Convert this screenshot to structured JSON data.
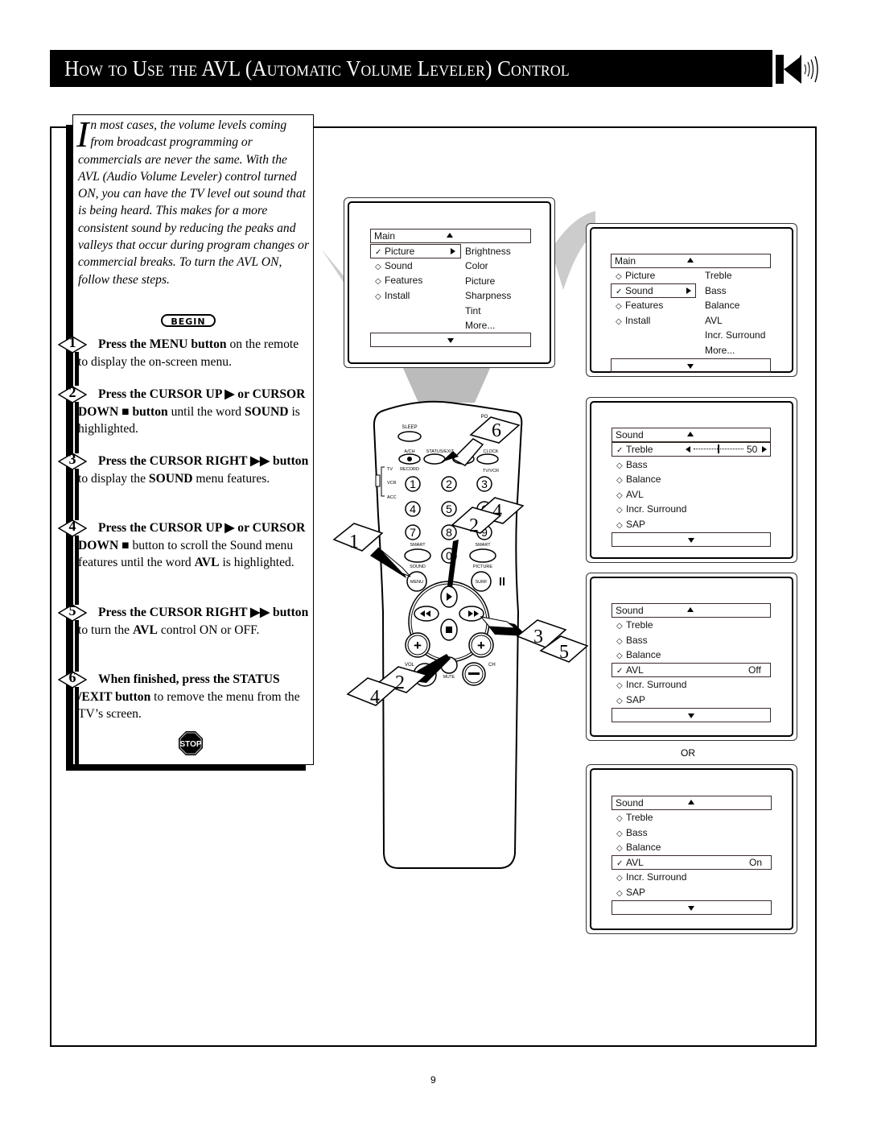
{
  "header": {
    "title": "How to Use the AVL (Automatic Volume Leveler) Control",
    "icon": "speaker-icon"
  },
  "intro": {
    "dropcap": "I",
    "text": "n most cases, the volume levels coming from broadcast programming or commercials are never the same.  With the AVL (Audio Volume Leveler) control turned ON, you can have the TV level out sound that is being heard.  This makes for a more consistent sound by reducing the peaks and valleys that occur during program changes or commercial breaks.  To turn the AVL ON, follow these steps.",
    "begin_label": "BEGIN"
  },
  "steps": [
    {
      "number": "1",
      "bold": "Press the MENU button",
      "rest": " on the remote to display the on-screen menu."
    },
    {
      "number": "2",
      "bold": "Press the CURSOR UP ▶ or CURSOR DOWN ■ button",
      "rest": " until the word ",
      "bold2": "SOUND",
      "rest2": " is highlighted."
    },
    {
      "number": "3",
      "bold": "Press the CURSOR RIGHT ▶▶ button",
      "rest": " to display the ",
      "bold2": "SOUND",
      "rest2": " menu features."
    },
    {
      "number": "4",
      "bold": "Press the CURSOR UP ▶ or CURSOR DOWN ■",
      "rest": " button to scroll the Sound menu features until the word ",
      "bold2": "AVL",
      "rest2": " is highlighted."
    },
    {
      "number": "5",
      "bold": "Press the CURSOR RIGHT ▶▶ button",
      "rest": " to turn the ",
      "bold2": "AVL",
      "rest2": " control ON or OFF."
    },
    {
      "number": "6",
      "bold": "When finished, press the STATUS /EXIT button",
      "rest": " to remove the menu from the TV’s screen."
    }
  ],
  "stop_label": "STOP",
  "screens": {
    "main_picture": {
      "header": "Main",
      "items": [
        {
          "label": "Picture",
          "marker": "✓",
          "selected": true
        },
        {
          "label": "Sound",
          "marker": "◇"
        },
        {
          "label": "Features",
          "marker": "◇"
        },
        {
          "label": "Install",
          "marker": "◇"
        }
      ],
      "submenu": [
        "Brightness",
        "Color",
        "Picture",
        "Sharpness",
        "Tint",
        "More..."
      ]
    },
    "main_sound": {
      "header": "Main",
      "items": [
        {
          "label": "Picture",
          "marker": "◇"
        },
        {
          "label": "Sound",
          "marker": "✓",
          "selected": true
        },
        {
          "label": "Features",
          "marker": "◇"
        },
        {
          "label": "Install",
          "marker": "◇"
        }
      ],
      "submenu": [
        "Treble",
        "Bass",
        "Balance",
        "AVL",
        "Incr. Surround",
        "More..."
      ]
    },
    "sound_treble": {
      "header": "Sound",
      "items": [
        {
          "label": "Treble",
          "marker": "✓",
          "selected": true,
          "value": "50"
        },
        {
          "label": "Bass",
          "marker": "◇"
        },
        {
          "label": "Balance",
          "marker": "◇"
        },
        {
          "label": "AVL",
          "marker": "◇"
        },
        {
          "label": "Incr. Surround",
          "marker": "◇"
        },
        {
          "label": "SAP",
          "marker": "◇"
        }
      ],
      "treble_slider_level": 0.5
    },
    "sound_avl_off": {
      "header": "Sound",
      "items": [
        {
          "label": "Treble",
          "marker": "◇"
        },
        {
          "label": "Bass",
          "marker": "◇"
        },
        {
          "label": "Balance",
          "marker": "◇"
        },
        {
          "label": "AVL",
          "marker": "✓",
          "selected": true,
          "value": "Off"
        },
        {
          "label": "Incr. Surround",
          "marker": "◇"
        },
        {
          "label": "SAP",
          "marker": "◇"
        }
      ]
    },
    "or_label": "OR",
    "sound_avl_on": {
      "header": "Sound",
      "items": [
        {
          "label": "Treble",
          "marker": "◇"
        },
        {
          "label": "Bass",
          "marker": "◇"
        },
        {
          "label": "Balance",
          "marker": "◇"
        },
        {
          "label": "AVL",
          "marker": "✓",
          "selected": true,
          "value": "On"
        },
        {
          "label": "Incr. Surround",
          "marker": "◇"
        },
        {
          "label": "SAP",
          "marker": "◇"
        }
      ]
    }
  },
  "remote": {
    "labels": {
      "sleep": "SLEEP",
      "ach": "A/CH",
      "status_exit": "STATUS/EXIT",
      "clock": "CLOCK",
      "record": "RECORD",
      "tvvcr": "TV/VCR",
      "tv": "TV",
      "vcr": "VCR",
      "acc": "ACC",
      "smart_sound_top": "SMART",
      "sound": "SOUND",
      "smart_picture_top": "SMART",
      "picture": "PICTURE",
      "menu": "MENU",
      "surf": "SURF",
      "vol": "VOL",
      "ch": "CH",
      "mute": "MUTE",
      "power_partial": "PO"
    },
    "digits": [
      "1",
      "2",
      "3",
      "4",
      "5",
      "6",
      "7",
      "8",
      "9",
      "0"
    ],
    "callouts": [
      "6",
      "4",
      "2",
      "1",
      "3",
      "5",
      "2",
      "4"
    ]
  },
  "footer": {
    "page_number": "9"
  }
}
